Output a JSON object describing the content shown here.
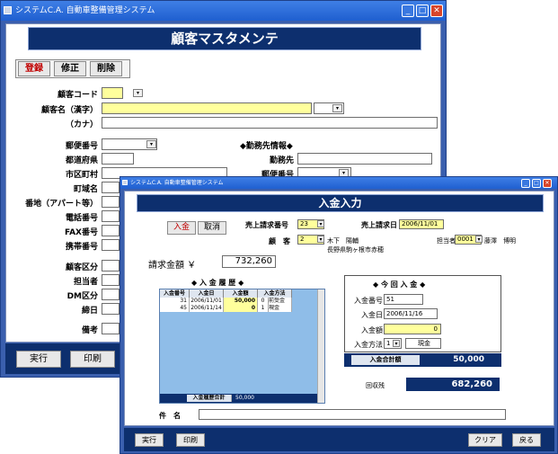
{
  "customer_window": {
    "title": "システムC.A.  自動車整備管理システム",
    "window_buttons": {
      "minimize": "_",
      "maximize": "□",
      "close": "✕"
    },
    "header": "顧客マスタメンテ",
    "mode_buttons": [
      "登録",
      "修正",
      "削除"
    ],
    "labels": {
      "customer_code": "顧客コード",
      "name_kanji": "顧客名（漢字）",
      "name_kana": "（カナ）",
      "postal": "郵便番号",
      "prefecture": "都道府県",
      "city": "市区町村",
      "town": "町域名",
      "address": "番地（アパート等）",
      "phone": "電話番号",
      "fax": "FAX番号",
      "mobile": "携帯番号",
      "customer_type": "顧客区分",
      "staff": "担当者",
      "dm_type": "DM区分",
      "closing_day": "締日",
      "notes": "備考",
      "work_info": "◆勤務先情報◆",
      "workplace": "勤務先",
      "work_postal": "郵便番号"
    },
    "footer_buttons": {
      "execute": "実行",
      "print": "印刷"
    }
  },
  "payment_window": {
    "title": "システムC.A.  自動車整備管理システム",
    "window_buttons": {
      "minimize": "_",
      "maximize": "□",
      "close": "✕"
    },
    "header": "入金入力",
    "mode_buttons": {
      "input": "入金",
      "cancel": "取消"
    },
    "sales_no_label": "売上請求番号",
    "sales_no": "23",
    "billing_date_label": "売上請求日",
    "billing_date": "2006/11/01",
    "customer_label": "顧　客",
    "customer_code": "2",
    "customer_name": "木下　陽輔",
    "address": "長野県駒ヶ根市赤穂",
    "staff_label": "担当者",
    "staff_code": "0001",
    "staff_name": "藤澤　博明",
    "billing_amount_label": "請求金額 ￥",
    "billing_amount": "732,260",
    "history_title": "◆ 入 金 履 歴 ◆",
    "history_headers": [
      "入金番号",
      "入金日",
      "入金額",
      "入金方法"
    ],
    "history_rows": [
      {
        "no": "31",
        "date": "2006/11/01",
        "amount": "50,000",
        "method_code": "0",
        "method": "前受金"
      },
      {
        "no": "45",
        "date": "2006/11/14",
        "amount": "0",
        "method_code": "1",
        "method": "現金"
      }
    ],
    "history_total_label": "入金履歴合計",
    "history_total": "50,000",
    "current_title": "◆ 今 回 入 金 ◆",
    "current_no_label": "入金番号",
    "current_no": "51",
    "current_date_label": "入金日",
    "current_date": "2006/11/16",
    "current_amount_label": "入金額",
    "current_amount": "0",
    "current_method_label": "入金方法",
    "current_method_code": "1",
    "current_method": "現金",
    "total_label": "入金合計額",
    "total": "50,000",
    "remaining_label": "回収残",
    "remaining": "682,260",
    "subject_label": "件　名",
    "subject": "",
    "footer_buttons": {
      "execute": "実行",
      "print": "印刷",
      "clear": "クリア",
      "back": "戻る"
    }
  },
  "colors": {
    "window_frame": "#3a5fae",
    "header_navy": "#0d2f6e",
    "titlebar_blue": "#1f5fd0",
    "highlight_yellow": "#ffff9c",
    "grid_blue": "#8fbde8"
  }
}
